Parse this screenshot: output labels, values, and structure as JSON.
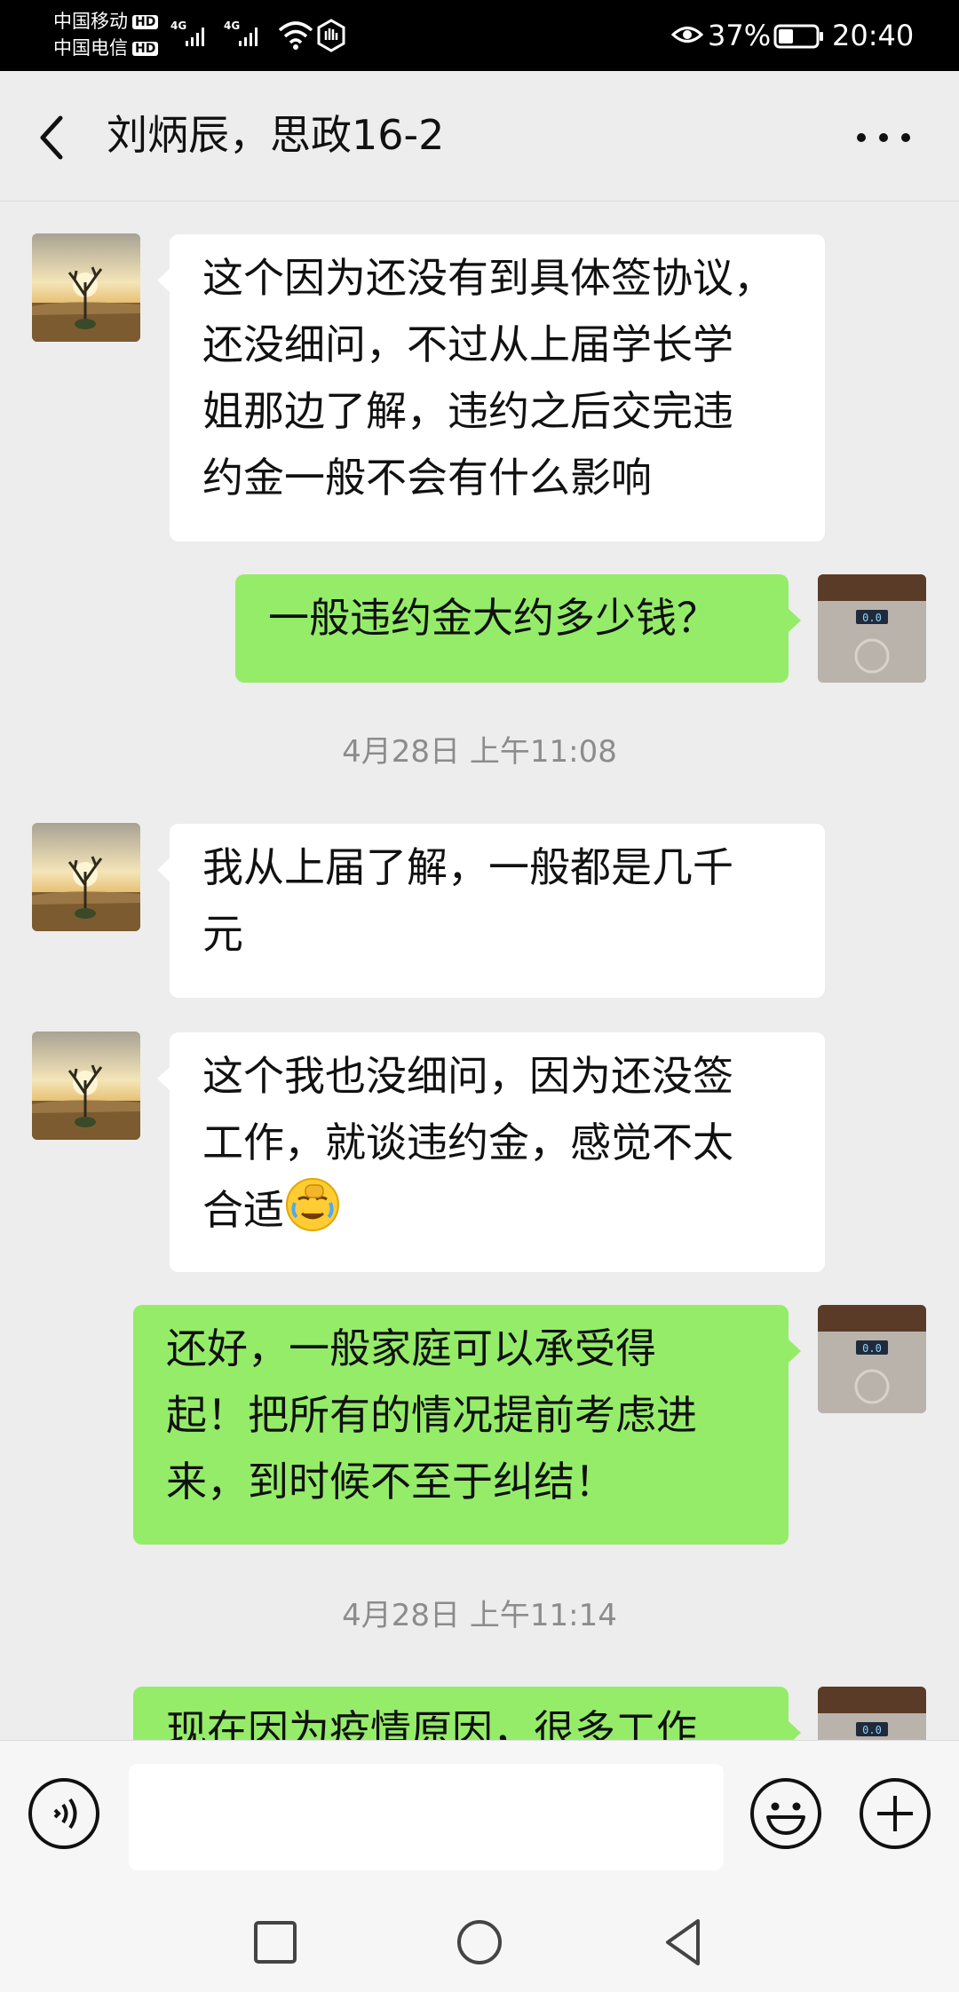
{
  "status_bar": {
    "carrier1": "中国移动",
    "carrier2": "中国电信",
    "hd_badge": "HD",
    "network1": "4G",
    "network2": "4G",
    "battery_percent": "37%",
    "time": "20:40"
  },
  "header": {
    "title": "刘炳辰，思政16-2"
  },
  "messages": [
    {
      "side": "in",
      "text": [
        "这个因为还没有到具体签协议，",
        "还没细问，不过从上届学长学",
        "姐那边了解，违约之后交完违",
        "约金一般不会有什么影响"
      ]
    },
    {
      "side": "out",
      "text": [
        "一般违约金大约多少钱？"
      ]
    },
    {
      "type": "time",
      "text": "4月28日 上午11:08"
    },
    {
      "side": "in",
      "text": [
        "我从上届了解，一般都是几千",
        "元"
      ]
    },
    {
      "side": "in",
      "text": [
        "这个我也没细问，因为还没签",
        "工作，就谈违约金，感觉不太",
        "合适"
      ],
      "emoji": "facepalm-crying-emoji"
    },
    {
      "side": "out",
      "text": [
        "还好，一般家庭可以承受得",
        "起！把所有的情况提前考虑进",
        "来，到时候不至于纠结！"
      ]
    },
    {
      "type": "time",
      "text": "4月28日 上午11:14"
    },
    {
      "side": "out",
      "text": [
        "现在因为疫情原因，很多工作"
      ]
    }
  ],
  "input_bar": {
    "placeholder": ""
  },
  "colors": {
    "background": "#ededed",
    "incoming_bubble": "#ffffff",
    "outgoing_bubble": "#95ec69",
    "timestamp": "#8c8c8c"
  },
  "icons": [
    "back-arrow-icon",
    "more-dots-icon",
    "voice-icon",
    "emoji-icon",
    "plus-icon",
    "recent-apps-icon",
    "home-icon",
    "back-nav-icon",
    "desert-avatar",
    "scale-avatar"
  ]
}
